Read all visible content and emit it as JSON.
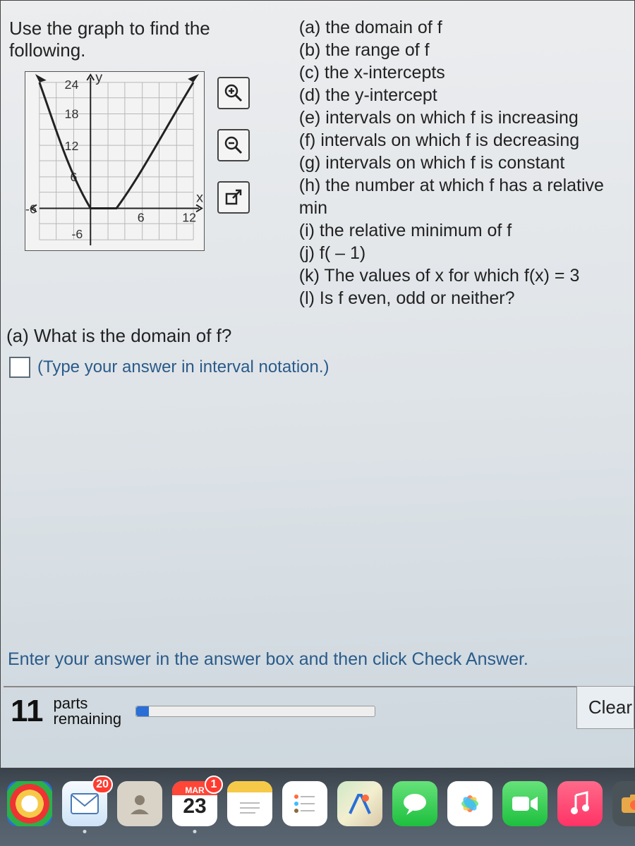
{
  "instruction": "Use the graph to find the following.",
  "subparts": [
    "(a) the domain of f",
    "(b) the range of f",
    "(c) the x-intercepts",
    "(d) the y-intercept",
    "(e) intervals on which f is increasing",
    "(f) intervals on which f is decreasing",
    "(g) intervals on which f is constant",
    "(h) the number at which f has a relative min",
    "(i) the relative minimum of f",
    "(j) f( – 1)",
    "(k) The values of x for which f(x) = 3",
    "(l) Is f even, odd or neither?"
  ],
  "question_a": "(a) What is the domain of f?",
  "answer_hint": "(Type your answer in interval notation.)",
  "enter_note": "Enter your answer in the answer box and then click Check Answer.",
  "parts": {
    "count": "11",
    "label_top": "parts",
    "label_bottom": "remaining"
  },
  "clear_label": "Clear",
  "tools": {
    "zoom_in": "zoom-in-icon",
    "zoom_out": "zoom-out-icon",
    "popout": "popout-icon"
  },
  "dock": {
    "chrome": "chrome-icon",
    "mail": {
      "name": "mail-icon",
      "badge": "20"
    },
    "contacts": "contacts-icon",
    "calendar": {
      "name": "calendar-icon",
      "month": "MAR",
      "day": "23",
      "badge": "1"
    },
    "notes": "notes-icon",
    "reminders": "reminders-icon",
    "maps": "maps-icon",
    "messages": "messages-icon",
    "photos": "photos-icon",
    "facetime": "facetime-icon",
    "music": "music-icon",
    "photobooth": "photobooth-icon",
    "safari": "safari-icon"
  },
  "chart_data": {
    "type": "line",
    "title": "",
    "xlabel": "x",
    "ylabel": "y",
    "xlim": [
      -6,
      12
    ],
    "ylim": [
      -6,
      24
    ],
    "x_ticks": [
      -6,
      6,
      12
    ],
    "y_ticks": [
      -6,
      6,
      12,
      18,
      24
    ],
    "series": [
      {
        "name": "f",
        "x": [
          -6,
          -4,
          -3,
          -2,
          -1,
          0,
          1,
          2,
          3,
          4,
          5,
          6,
          8,
          10,
          12
        ],
        "values": [
          24,
          14,
          9,
          5,
          2,
          0,
          0,
          0,
          0,
          2,
          5,
          9,
          14,
          20,
          24
        ]
      }
    ],
    "annotations": "Arrowheads on both ends of the curve and on both axes."
  }
}
